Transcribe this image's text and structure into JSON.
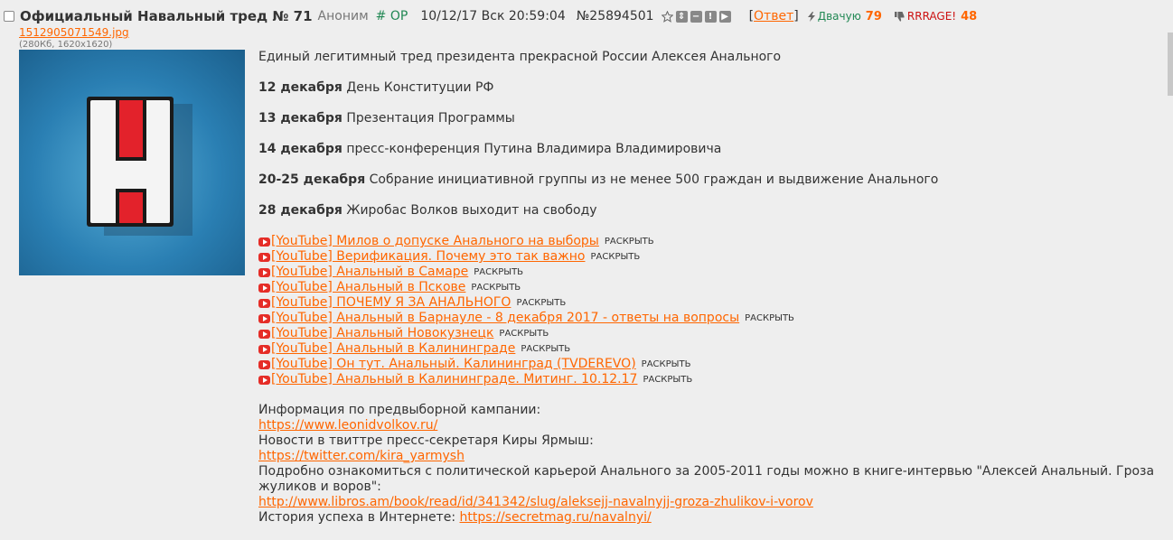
{
  "post": {
    "title": "Официальный Навальный тред № 71",
    "author": "Аноним",
    "op_tag": "# OP",
    "date": "10/12/17 Вск 20:59:04",
    "number": "№25894501",
    "reply_label": "Ответ",
    "like_label": "Двачую",
    "like_count": "79",
    "dislike_label": "RRRAGE!",
    "dislike_count": "48"
  },
  "file": {
    "name": "1512905071549.jpg",
    "meta": "(280Кб, 1620x1620)"
  },
  "message": {
    "intro": "Единый легитимный тред президента прекрасной России Алексея Анального",
    "events": [
      {
        "date": "12 декабря",
        "text": "День Конституции РФ"
      },
      {
        "date": "13 декабря",
        "text": "Презентация Программы"
      },
      {
        "date": "14 декабря",
        "text": "пресс-конференция Путина Владимира Владимировича"
      },
      {
        "date": "20-25 декабря",
        "text": "Собрание инициативной группы из не менее 500 граждан и выдвижение Анального"
      },
      {
        "date": "28 декабря",
        "text": "Жиробас Волков выходит на свободу"
      }
    ],
    "expand_label": "РАСКРЫТЬ",
    "videos": [
      "[YouTube] Милов о допуске Анального на выборы",
      "[YouTube] Верификация. Почему это так важно",
      "[YouTube] Анальный в Самаре",
      "[YouTube] Анальный в Пскове",
      "[YouTube] ПОЧЕМУ Я ЗА АНАЛЬНОГО",
      "[YouTube] Анальный в Барнауле - 8 декабря 2017 - ответы на вопросы",
      "[YouTube] Анальный Новокузнецк",
      "[YouTube] Анальный в Калининграде",
      "[YouTube] Он тут. Анальный. Калининград (TVDEREVO)",
      "[YouTube] Анальный в Калининграде. Митинг. 10.12.17"
    ],
    "info1_text": "Информация по предвыборной кампании:",
    "info1_link": "https://www.leonidvolkov.ru/",
    "info2_text": "Новости в твиттре пресс-секретаря Киры Ярмыш:",
    "info2_link": "https://twitter.com/kira_yarmysh",
    "info3_text": "Подробно ознакомиться с политической карьерой Анального за 2005-2011 годы можно в книге-интервью \"Алексей Анальный. Гроза жуликов и воров\":",
    "info3_link": "http://www.libros.am/book/read/id/341342/slug/aleksejj-navalnyjj-groza-zhulikov-i-vorov",
    "info4_text": "История успеха в Интернете:",
    "info4_link": "https://secretmag.ru/navalnyi/"
  },
  "colors": {
    "background": "#eeeeee",
    "link": "#ff6600",
    "op": "#228854",
    "dislike": "#cc1111",
    "pin_red": "#e3222b"
  }
}
